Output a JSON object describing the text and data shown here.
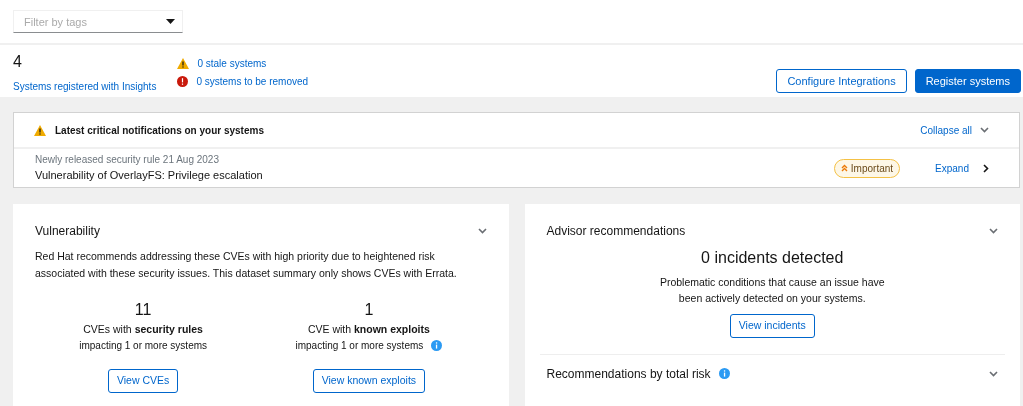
{
  "filter": {
    "placeholder": "Filter by tags"
  },
  "summary": {
    "count": "4",
    "label": "Systems registered with Insights",
    "alerts": [
      {
        "kind": "warning",
        "text": "0 stale systems"
      },
      {
        "kind": "danger",
        "text": "0 systems to be removed"
      }
    ],
    "buttons": [
      {
        "kind": "secondary",
        "label": "Configure Integrations"
      },
      {
        "kind": "primary",
        "label": "Register systems"
      }
    ]
  },
  "notifications": {
    "title": "Latest critical notifications on your systems",
    "toggle": "Collapse all",
    "items": [
      {
        "subtitle": "Newly released security rule 21 Aug 2023",
        "title": "Vulnerability of OverlayFS: Privilege escalation",
        "severity": "Important",
        "action": "Expand"
      }
    ]
  },
  "vulnerability": {
    "title": "Vulnerability",
    "description": "Red Hat recommends addressing these CVEs with high priority due to heightened risk associated with these security issues. This dataset summary only shows CVEs with Errata.",
    "stats": [
      {
        "value": "11",
        "label": "CVEs with **security rules**",
        "sublabel": "impacting 1 or more systems",
        "info": false,
        "button": "View CVEs"
      },
      {
        "value": "1",
        "label": "CVE with **known exploits**",
        "sublabel": "impacting 1 or more systems",
        "info": true,
        "button": "View known exploits"
      }
    ]
  },
  "advisor": {
    "title": "Advisor recommendations",
    "heading": "0 incidents detected",
    "text": "Problematic conditions that cause an issue have been actively detected on your systems.",
    "button": "View incidents",
    "sections": [
      {
        "title": "Recommendations by total risk",
        "info": true
      }
    ]
  }
}
